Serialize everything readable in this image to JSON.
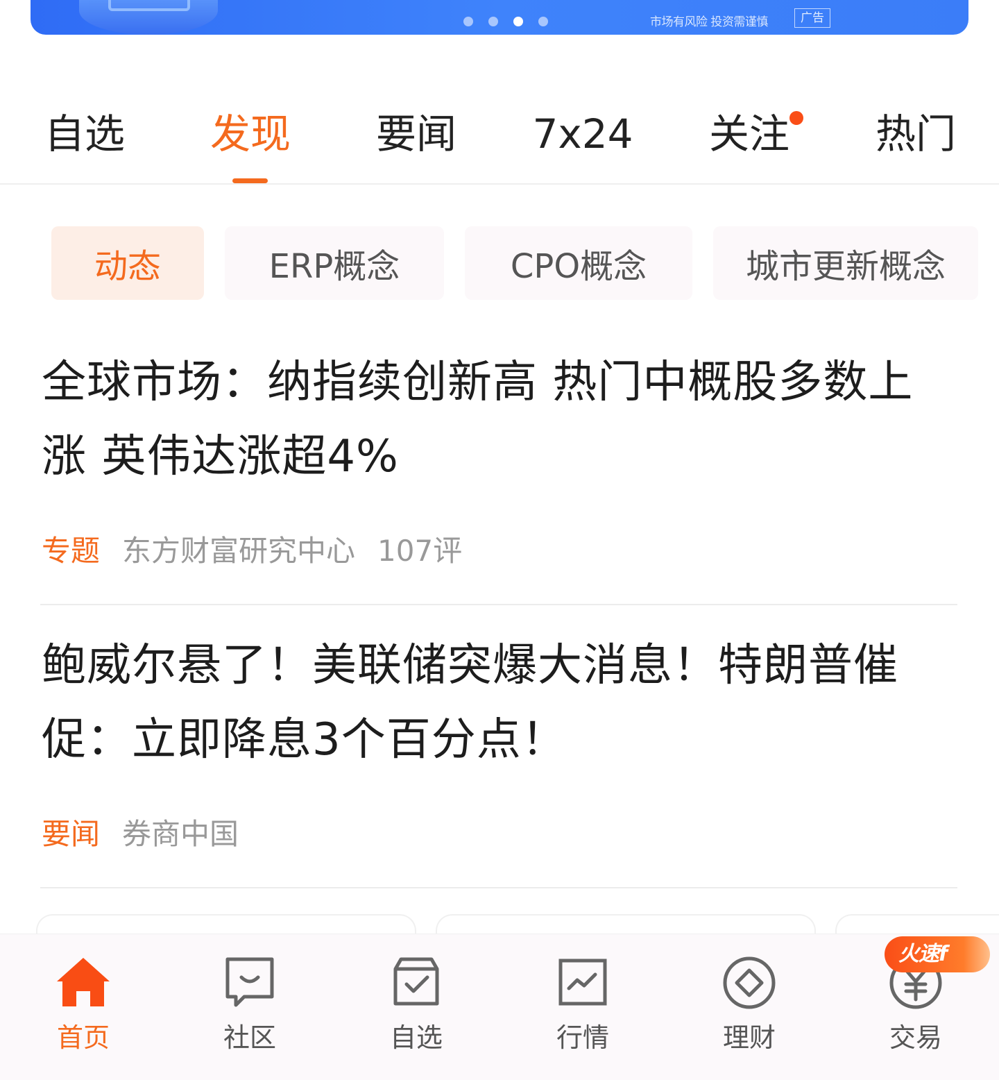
{
  "banner": {
    "disclaimer": "市场有风险 投资需谨慎",
    "ad_label": "广告",
    "page_dots": 4,
    "active_dot": 3
  },
  "tabs": [
    {
      "label": "自选",
      "active": false
    },
    {
      "label": "发现",
      "active": true
    },
    {
      "label": "要闻",
      "active": false
    },
    {
      "label": "7x24",
      "active": false
    },
    {
      "label": "关注",
      "active": false,
      "has_dot": true
    },
    {
      "label": "热门",
      "active": false
    }
  ],
  "chips": [
    {
      "label": "动态",
      "active": true
    },
    {
      "label": "ERP概念",
      "active": false
    },
    {
      "label": "CPO概念",
      "active": false
    },
    {
      "label": "城市更新概念",
      "active": false
    }
  ],
  "articles": [
    {
      "title_line1": "全球市场：纳指续创新高 热门中概股多数上",
      "title_line2": "涨 英伟达涨超4%",
      "tag": "专题",
      "source": "东方财富研究中心",
      "comments": "107评"
    },
    {
      "title_line1": "鲍威尔悬了！美联储突爆大消息！特朗普催",
      "title_line2": "促：立即降息3个百分点！",
      "tag": "要闻",
      "source": "券商中国",
      "comments": ""
    }
  ],
  "bottom_nav": [
    {
      "label": "首页",
      "icon": "home-icon",
      "active": true
    },
    {
      "label": "社区",
      "icon": "chat-bubble-icon",
      "active": false
    },
    {
      "label": "自选",
      "icon": "watchlist-check-icon",
      "active": false
    },
    {
      "label": "行情",
      "icon": "market-chart-icon",
      "active": false
    },
    {
      "label": "理财",
      "icon": "diamond-icon",
      "active": false
    },
    {
      "label": "交易",
      "icon": "yen-coin-icon",
      "active": false
    }
  ],
  "trade_badge": "火速f",
  "colors": {
    "accent": "#f46a1e",
    "banner_blue": "#3b7df8",
    "text": "#1d1d1d",
    "muted": "#999999"
  }
}
